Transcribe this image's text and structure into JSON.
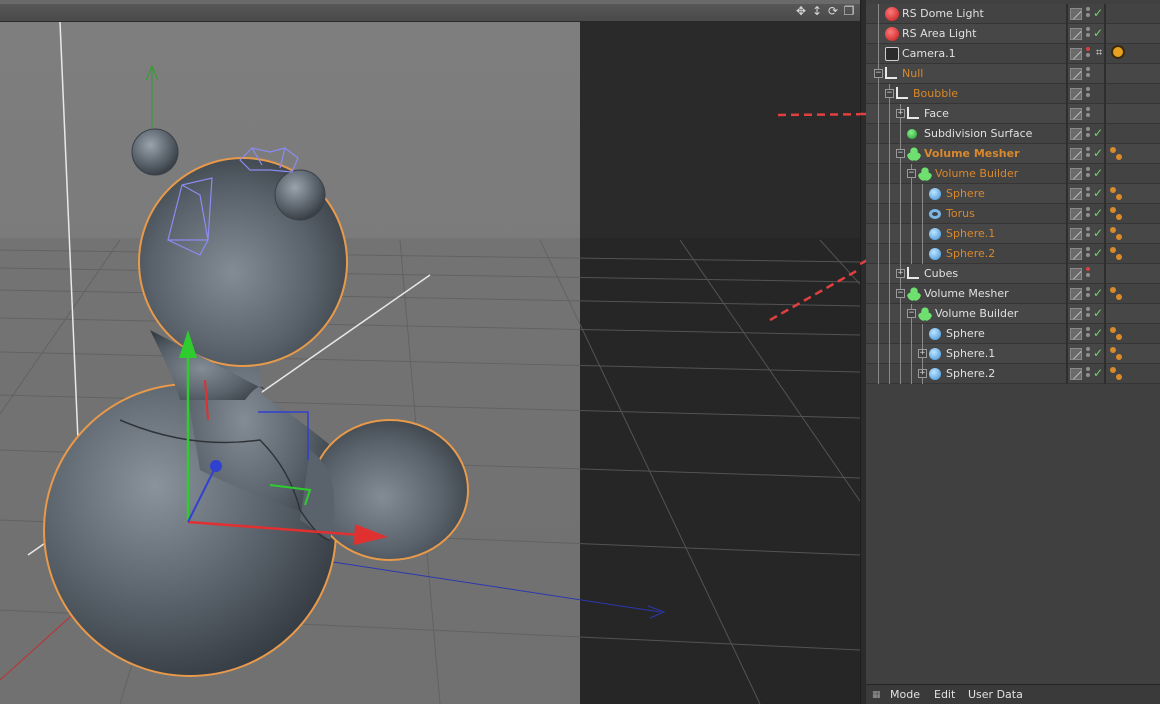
{
  "viewport": {
    "nav_icons": [
      "move-icon",
      "zoom-icon",
      "rotate-icon",
      "maximize-icon"
    ],
    "colors": {
      "background_left": "#7a7a7a",
      "background_right": "#2a2a2a",
      "object": "#5d6670",
      "highlight": "#e89a4a",
      "axis_x": "#e03030",
      "axis_y": "#30c030",
      "axis_z": "#3040d0"
    }
  },
  "object_manager": {
    "rows": [
      {
        "name": "RS Dome Light",
        "icon": "rs-light-icon",
        "indent": 0,
        "expander": "",
        "style": "normal",
        "check": true,
        "tag": "",
        "dots_red": false
      },
      {
        "name": "RS Area Light",
        "icon": "rs-light-icon",
        "indent": 0,
        "expander": "",
        "style": "normal",
        "check": true,
        "tag": "",
        "dots_red": false
      },
      {
        "name": "Camera.1",
        "icon": "camera-icon",
        "indent": 0,
        "expander": "",
        "style": "normal",
        "check": false,
        "tag": "camera-tags",
        "dots_red": true
      },
      {
        "name": "Null",
        "icon": "null-icon",
        "indent": 0,
        "expander": "−",
        "style": "orange",
        "check": false,
        "tag": "",
        "dots_red": false
      },
      {
        "name": "Boubble",
        "icon": "null-icon",
        "indent": 1,
        "expander": "−",
        "style": "orange",
        "check": false,
        "tag": "",
        "dots_red": false
      },
      {
        "name": "Face",
        "icon": "null-icon",
        "indent": 2,
        "expander": "+",
        "style": "normal",
        "check": false,
        "tag": "",
        "dots_red": false
      },
      {
        "name": "Subdivision Surface",
        "icon": "subdivision-icon",
        "indent": 2,
        "expander": "",
        "style": "normal",
        "check": true,
        "tag": "",
        "dots_red": false
      },
      {
        "name": "Volume Mesher",
        "icon": "volume-mesher-icon",
        "indent": 2,
        "expander": "−",
        "style": "orange-bold",
        "check": true,
        "tag": "phong",
        "dots_red": false
      },
      {
        "name": "Volume Builder",
        "icon": "volume-builder-icon",
        "indent": 3,
        "expander": "−",
        "style": "orange",
        "check": true,
        "tag": "",
        "dots_red": false
      },
      {
        "name": "Sphere",
        "icon": "sphere-icon",
        "indent": 4,
        "expander": "",
        "style": "orange",
        "check": true,
        "tag": "phong",
        "dots_red": false
      },
      {
        "name": "Torus",
        "icon": "torus-icon",
        "indent": 4,
        "expander": "",
        "style": "orange",
        "check": true,
        "tag": "phong",
        "dots_red": false
      },
      {
        "name": "Sphere.1",
        "icon": "sphere-icon",
        "indent": 4,
        "expander": "",
        "style": "orange",
        "check": true,
        "tag": "phong",
        "dots_red": false
      },
      {
        "name": "Sphere.2",
        "icon": "sphere-icon",
        "indent": 4,
        "expander": "",
        "style": "orange",
        "check": true,
        "tag": "phong",
        "dots_red": false
      },
      {
        "name": "Cubes",
        "icon": "null-icon",
        "indent": 2,
        "expander": "+",
        "style": "normal",
        "check": false,
        "tag": "",
        "dots_red": true
      },
      {
        "name": "Volume Mesher",
        "icon": "volume-mesher-icon",
        "indent": 2,
        "expander": "−",
        "style": "normal",
        "check": true,
        "tag": "phong",
        "dots_red": false
      },
      {
        "name": "Volume Builder",
        "icon": "volume-builder-icon",
        "indent": 3,
        "expander": "−",
        "style": "normal",
        "check": true,
        "tag": "",
        "dots_red": false
      },
      {
        "name": "Sphere",
        "icon": "sphere-icon",
        "indent": 4,
        "expander": "",
        "style": "normal",
        "check": true,
        "tag": "phong",
        "dots_red": false
      },
      {
        "name": "Sphere.1",
        "icon": "sphere-icon",
        "indent": 4,
        "expander": "+",
        "style": "normal",
        "check": true,
        "tag": "phong",
        "dots_red": false
      },
      {
        "name": "Sphere.2",
        "icon": "sphere-icon",
        "indent": 4,
        "expander": "+",
        "style": "normal",
        "check": true,
        "tag": "phong",
        "dots_red": false
      }
    ]
  },
  "bottom_bar": {
    "mode": "Mode",
    "edit": "Edit",
    "user_data": "User Data"
  },
  "annotation_color": "#e04040"
}
